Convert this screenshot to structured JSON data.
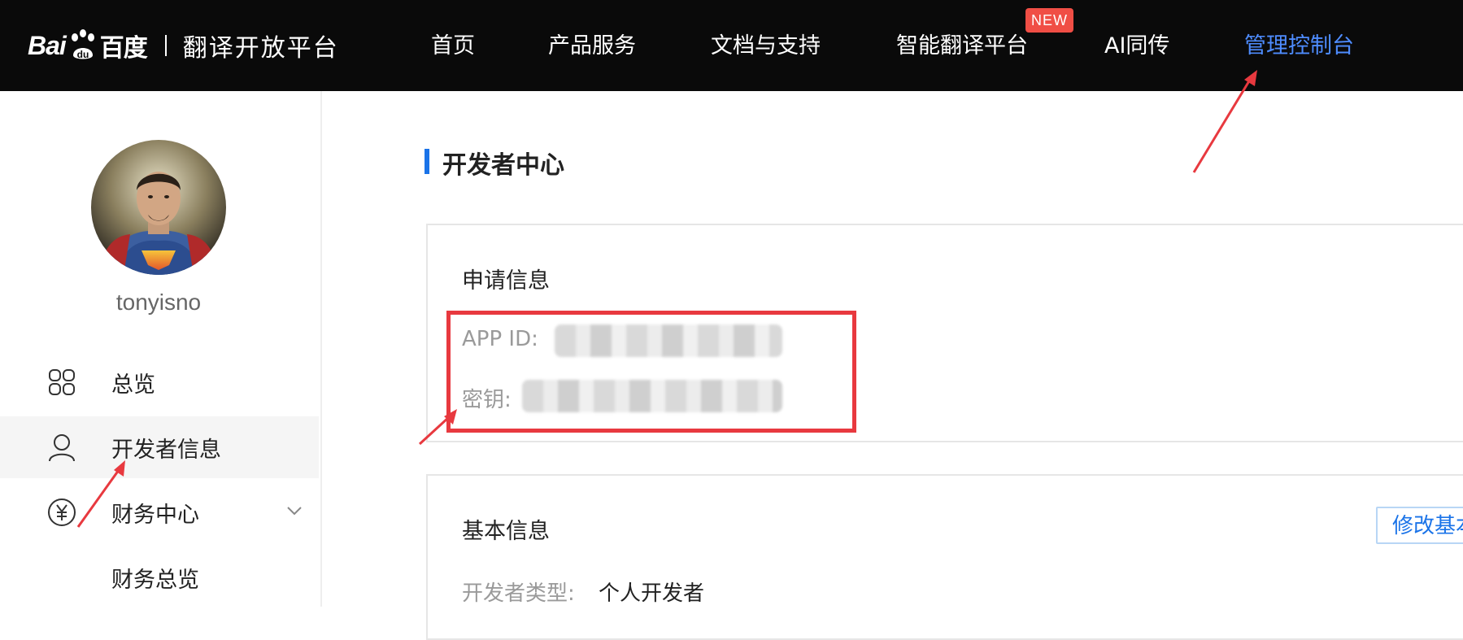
{
  "logo": {
    "bai": "Bai",
    "cn": "百度",
    "product": "翻译开放平台"
  },
  "nav": {
    "items": [
      {
        "label": "首页"
      },
      {
        "label": "产品服务"
      },
      {
        "label": "文档与支持"
      },
      {
        "label": "智能翻译平台"
      },
      {
        "label": "AI同传"
      },
      {
        "label": "管理控制台"
      }
    ],
    "badge": "NEW",
    "active_color": "#4e8cff"
  },
  "sidebar": {
    "username": "tonyisno",
    "items": [
      {
        "label": "总览",
        "icon": "grid-icon"
      },
      {
        "label": "开发者信息",
        "icon": "user-icon"
      },
      {
        "label": "财务中心",
        "icon": "yen-icon"
      },
      {
        "label": "财务总览",
        "icon": ""
      }
    ]
  },
  "main": {
    "page_title": "开发者中心",
    "application_card": {
      "title": "申请信息",
      "app_id_label": "APP ID:",
      "secret_label": "密钥:"
    },
    "basic_card": {
      "title": "基本信息",
      "edit_button": "修改基本",
      "dev_type_label": "开发者类型:",
      "dev_type_value": "个人开发者"
    }
  },
  "colors": {
    "accent": "#1a73e8",
    "annotation": "#e8393f",
    "topbar": "#0a0a0a"
  }
}
